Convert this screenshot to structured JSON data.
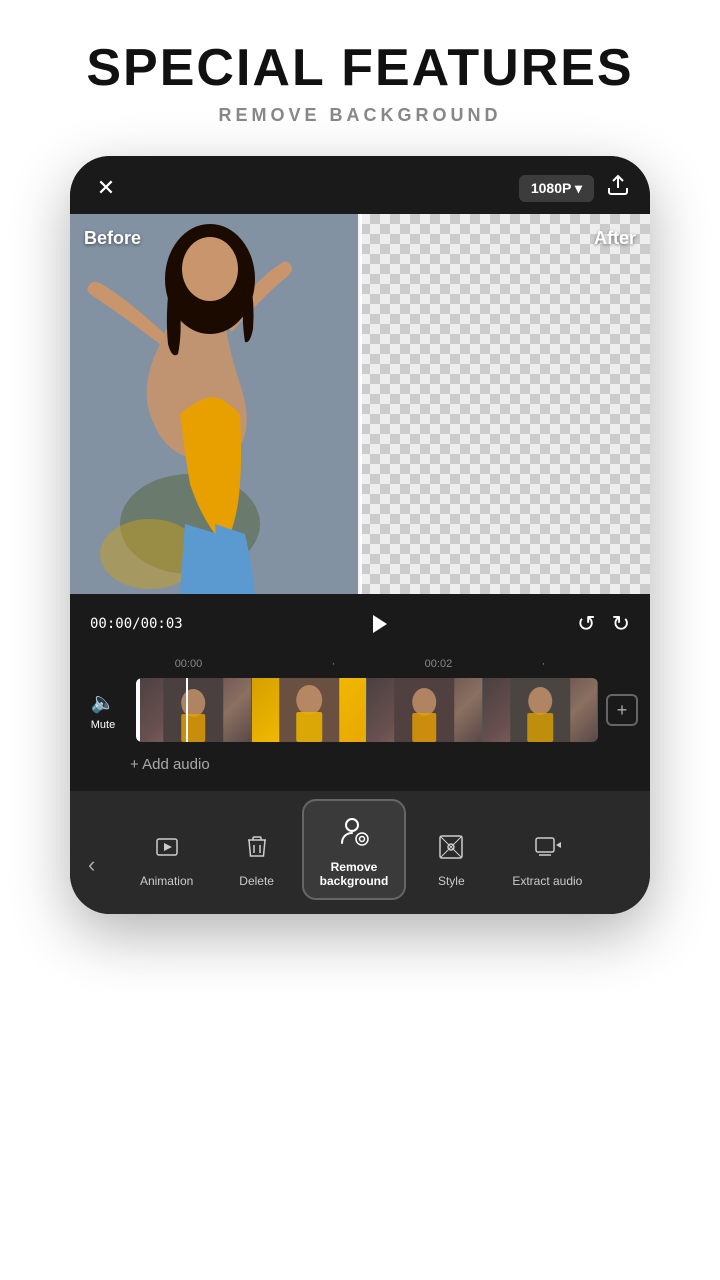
{
  "header": {
    "title": "SPECIAL FEATURES",
    "subtitle": "REMOVE BACKGROUND"
  },
  "phone": {
    "top_bar": {
      "close_label": "✕",
      "resolution": "1080P ▾",
      "upload_icon": "upload"
    },
    "preview": {
      "before_label": "Before",
      "after_label": "After"
    },
    "playback": {
      "time_current": "00:00",
      "time_total": "00:03",
      "time_display": "00:00/00:03"
    },
    "timeline": {
      "markers": [
        "00:00",
        "00:02"
      ],
      "mute_label": "Mute"
    },
    "add_audio_label": "+ Add audio",
    "toolbar": {
      "back_icon": "‹",
      "items": [
        {
          "id": "animation",
          "label": "Animation",
          "icon": "▶"
        },
        {
          "id": "delete",
          "label": "Delete",
          "icon": "🗑"
        },
        {
          "id": "remove-background",
          "label": "Remove\nbackground",
          "icon": "👤",
          "active": true
        },
        {
          "id": "style",
          "label": "Style",
          "icon": "◈"
        },
        {
          "id": "extract-audio",
          "label": "Extract audio",
          "icon": "▶"
        }
      ]
    }
  }
}
